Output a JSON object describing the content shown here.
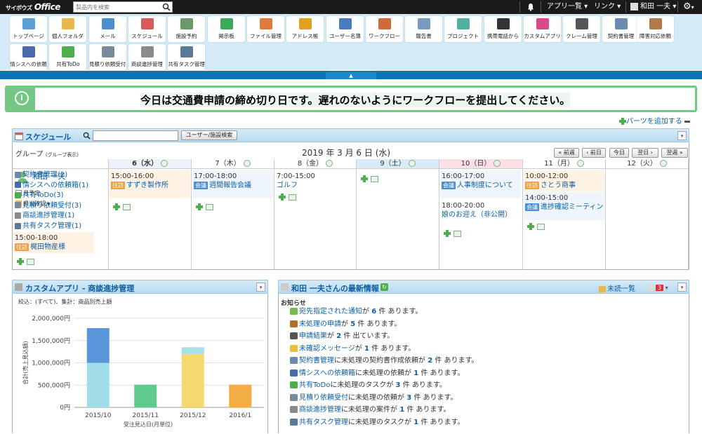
{
  "topbar": {
    "logo_brand": "サイボウズ",
    "logo_product": "Office",
    "search_placeholder": "製品内を検索",
    "app_list": "アプリ一覧",
    "link": "リンク",
    "user": "和田 一夫"
  },
  "apps": [
    {
      "label": "トップページ",
      "color": "#5aa0d8"
    },
    {
      "label": "個人フォルダ",
      "color": "#e8b84a"
    },
    {
      "label": "メール",
      "color": "#4a90d0"
    },
    {
      "label": "スケジュール",
      "color": "#d85a5a"
    },
    {
      "label": "施設予約",
      "color": "#6a9a6a"
    },
    {
      "label": "掲示板",
      "color": "#3aaa5a"
    },
    {
      "label": "ファイル管理",
      "color": "#e07a3a"
    },
    {
      "label": "アドレス帳",
      "color": "#e0a020"
    },
    {
      "label": "ユーザー名簿",
      "color": "#4a7ac0"
    },
    {
      "label": "ワークフロー",
      "color": "#d06a3a"
    },
    {
      "label": "報告書",
      "color": "#7a9ac0"
    },
    {
      "label": "プロジェクト",
      "color": "#50b0a0"
    },
    {
      "label": "携帯電話から",
      "color": "#333333"
    },
    {
      "label": "カスタムアプリ",
      "color": "#d84a8a"
    },
    {
      "label": "クレーム管理",
      "color": "#555555"
    },
    {
      "label": "契約書管理",
      "color": "#6a8ab0"
    },
    {
      "label": "障害対応依頼",
      "color": "#b07a4a"
    },
    {
      "label": "情シスへの依頼",
      "color": "#4a6ab0"
    },
    {
      "label": "共有ToDo",
      "color": "#4cae4c"
    },
    {
      "label": "見積り依頼受付",
      "color": "#7a8a9a"
    },
    {
      "label": "商談進捗管理",
      "color": "#8a8a8a"
    },
    {
      "label": "共有タスク管理",
      "color": "#5a7a9a"
    }
  ],
  "announcement": "今日は交通費申請の締め切り日です。遅れのないようにワークフローを提出してください。",
  "add_parts": "パーツを追加する",
  "schedule": {
    "title": "スケジュール",
    "search_btn": "ユーザー/施設検索",
    "group_label": "グループ",
    "group_sub": "(グループ表示)",
    "date_title": "2019 年 3 月 6 日 (水)",
    "nav": {
      "prev_week": "« 前週",
      "prev_day": "‹ 前日",
      "today": "今日",
      "next_day": "翌日 ›",
      "next_week": "翌週 »"
    },
    "user": "和田 一夫",
    "month_view": "月予定",
    "responsible": "担当確認",
    "days": [
      "6（水）",
      "7（木）",
      "8（金）",
      "9（土）",
      "10（日）",
      "11（月）",
      "12（火）"
    ],
    "todos": [
      "契約書管理(2)",
      "情シスへの依頼箱(1)",
      "共有ToDo(3)",
      "見積り依頼受付(3)",
      "商談進捗管理(1)",
      "共有タスク管理(1)"
    ],
    "events": {
      "d6": {
        "time": "15:00-18:00",
        "tag": "往訪",
        "title": "梶田物産様"
      },
      "d7": {
        "time": "15:00-16:00",
        "tag": "往訪",
        "title": "すずき製作所"
      },
      "d8": {
        "time": "17:00-18:00",
        "tag": "会議",
        "title": "週間報告会議"
      },
      "d9": {
        "time": "7:00-15:00",
        "title": "ゴルフ"
      },
      "d11a": {
        "time": "16:00-17:00",
        "tag": "会議",
        "title": "人事制度について"
      },
      "d11b": {
        "time": "18:00-20:00",
        "title": "娘のお迎え（非公開）"
      },
      "d12a": {
        "time": "10:00-12:00",
        "tag": "往訪",
        "title": "さとう商事"
      },
      "d12b": {
        "time": "14:00-15:00",
        "tag": "会議",
        "title": "進捗確認ミーティング"
      }
    },
    "tag_colors": {
      "往訪": "#f0a040",
      "会議": "#4a90d0"
    }
  },
  "custom_app": {
    "title": "カスタムアプリ - 商談進捗管理",
    "filter": "絞込：(すべて)、集計：商品別売上額"
  },
  "chart_data": {
    "type": "bar",
    "stacked": true,
    "categories": [
      "2015/10",
      "2015/11",
      "2015/12",
      "2016/1"
    ],
    "series": [
      {
        "values": [
          1000000,
          0,
          0,
          0
        ],
        "color": "#9fdde8"
      },
      {
        "values": [
          780000,
          0,
          0,
          0
        ],
        "color": "#5b95d9"
      },
      {
        "values": [
          0,
          510000,
          0,
          0
        ],
        "color": "#5fc98e"
      },
      {
        "values": [
          0,
          0,
          1200000,
          0
        ],
        "color": "#f6d870"
      },
      {
        "values": [
          0,
          0,
          150000,
          0
        ],
        "color": "#a8e0e6"
      },
      {
        "values": [
          0,
          0,
          0,
          510000
        ],
        "color": "#f2ae44"
      }
    ],
    "yticks": [
      "2,000,000円",
      "1,500,000円",
      "1,000,000円",
      "500,000円",
      "0円"
    ],
    "ylim": [
      0,
      2000000
    ],
    "ylabel": "合計(売上見込額)",
    "xlabel": "受注見込日(月単位)"
  },
  "news": {
    "title": "和田 一夫さんの最新情報",
    "unread": "未読一覧",
    "badge": "3",
    "section": "お知らせ",
    "items": [
      {
        "pre": "",
        "link": "宛先指定された通知",
        "mid": "が",
        "num": "6",
        "post": "件 あります。",
        "color": "#7ab84a"
      },
      {
        "pre": "",
        "link": "未処理の申請",
        "mid": "が",
        "num": "5",
        "post": "件 あります。",
        "color": "#b0702a"
      },
      {
        "pre": "",
        "link": "申請結果",
        "mid": "が",
        "num": "2",
        "post": "件 出ています。",
        "color": "#555555"
      },
      {
        "pre": "",
        "link": "未確認メッセージ",
        "mid": "が",
        "num": "1",
        "post": "件 あります。",
        "color": "#e8c040"
      },
      {
        "pre": "",
        "link": "契約書管理",
        "mid": "に未処理の契約書作成依頼が",
        "num": "2",
        "post": "件 あります。",
        "color": "#6a8ab0"
      },
      {
        "pre": "",
        "link": "情シスへの依頼箱",
        "mid": "に未処理の依頼が",
        "num": "1",
        "post": "件 あります。",
        "color": "#4a6ab0"
      },
      {
        "pre": "",
        "link": "共有ToDo",
        "mid": "に未処理のタスクが",
        "num": "3",
        "post": "件 あります。",
        "color": "#4cae4c"
      },
      {
        "pre": "",
        "link": "見積り依頼受付",
        "mid": "に未処理の依頼が",
        "num": "3",
        "post": "件 あります。",
        "color": "#7a8a9a"
      },
      {
        "pre": "",
        "link": "商談進捗管理",
        "mid": "に未処理の案件が",
        "num": "1",
        "post": "件 あります。",
        "color": "#8a8a8a"
      },
      {
        "pre": "",
        "link": "共有タスク管理",
        "mid": "に未処理のタスクが",
        "num": "1",
        "post": "件 あります。",
        "color": "#5a7a9a"
      }
    ]
  }
}
